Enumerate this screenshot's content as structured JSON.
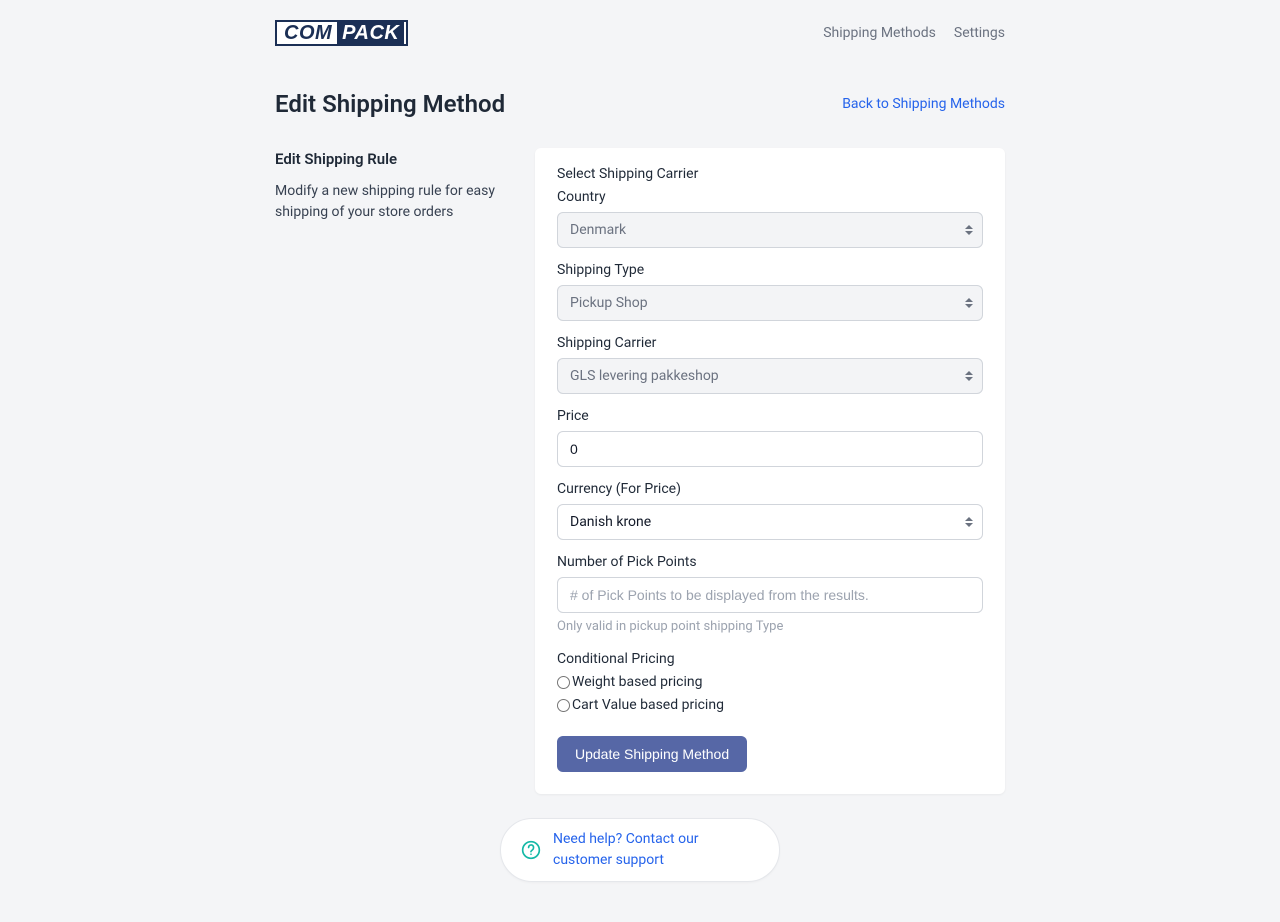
{
  "brand": {
    "segment_a": "COM",
    "segment_b": "PACK"
  },
  "nav": {
    "shipping_methods": "Shipping Methods",
    "settings": "Settings"
  },
  "titlebar": {
    "page_title": "Edit Shipping Method",
    "back_link": "Back to Shipping Methods"
  },
  "sidebar": {
    "title": "Edit Shipping Rule",
    "description": "Modify a new shipping rule for easy shipping of your store orders"
  },
  "form": {
    "section_label": "Select Shipping Carrier",
    "country": {
      "label": "Country",
      "value": "Denmark"
    },
    "shipping_type": {
      "label": "Shipping Type",
      "value": "Pickup Shop"
    },
    "shipping_carrier": {
      "label": "Shipping Carrier",
      "value": "GLS levering pakkeshop"
    },
    "price": {
      "label": "Price",
      "value": "0"
    },
    "currency": {
      "label": "Currency (For Price)",
      "value": "Danish krone"
    },
    "pick_points": {
      "label": "Number of Pick Points",
      "placeholder": "# of Pick Points to be displayed from the results.",
      "hint": "Only valid in pickup point shipping Type"
    },
    "conditional": {
      "title": "Conditional Pricing",
      "weight_label": "Weight based pricing",
      "cart_label": "Cart Value based pricing"
    },
    "submit_label": "Update Shipping Method"
  },
  "help": {
    "text": "Need help? Contact our customer support"
  },
  "colors": {
    "accent": "#5667a6",
    "link": "#2563eb"
  }
}
